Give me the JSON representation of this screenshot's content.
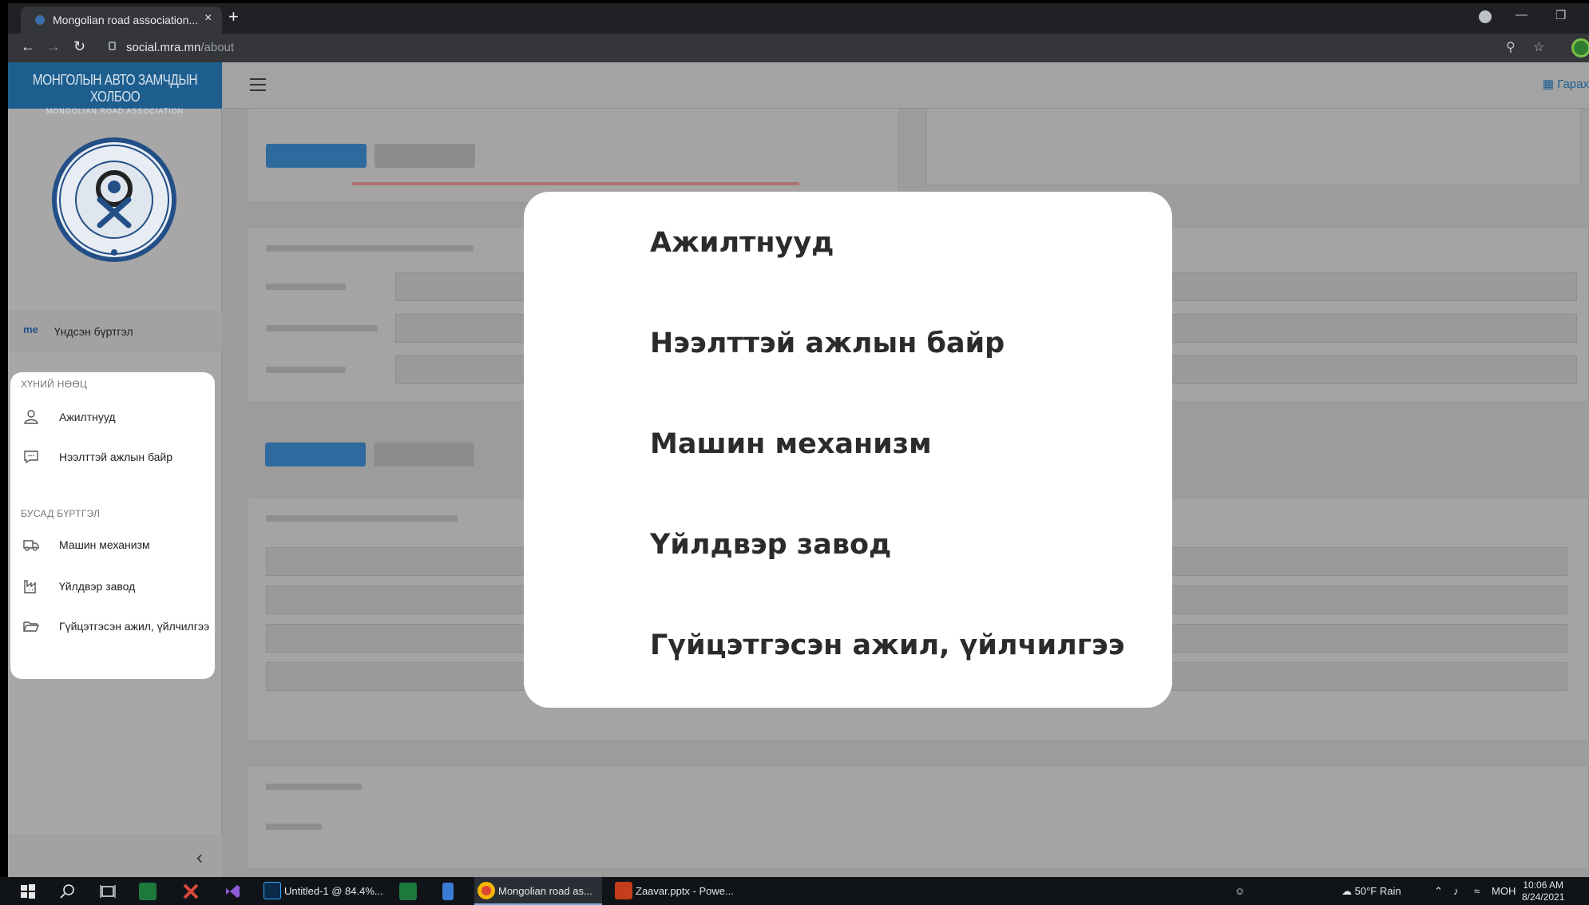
{
  "browser": {
    "tab_title": "Mongolian road association...",
    "new_tab": "+",
    "close_tab": "×",
    "url_host": "social.mra.mn",
    "url_path": "/about"
  },
  "sidebar": {
    "brand_title": "МОНГОЛЫН АВТО ЗАМЧДЫН ХОЛБОО",
    "brand_subtitle": "MONGOLIAN ROAD ASSOCIATION",
    "main_entry_badge": "me",
    "main_entry_label": "Үндсэн бүртгэл",
    "section_hr": "ХҮНИЙ НӨӨЦ",
    "section_other": "БУСАД БҮРТГЭЛ",
    "items": [
      {
        "label": "Ажилтнууд",
        "icon": "user-icon"
      },
      {
        "label": "Нээлттэй ажлын байр",
        "icon": "chat-icon"
      },
      {
        "label": "Машин механизм",
        "icon": "truck-icon"
      },
      {
        "label": "Үйлдвэр завод",
        "icon": "factory-icon"
      },
      {
        "label": "Гүйцэтгэсэн ажил, үйлчилгээ",
        "icon": "folder-icon"
      }
    ]
  },
  "topnav": {
    "logout_label": "Гарах"
  },
  "modal": {
    "items": [
      "Ажилтнууд",
      "Нээлттэй ажлын байр",
      "Машин механизм",
      "Үйлдвэр завод",
      "Гүйцэтгэсэн ажил, үйлчилгээ"
    ]
  },
  "taskbar": {
    "apps": [
      {
        "label": "Untitled-1 @ 84.4%..."
      },
      {
        "label": "Mongolian road as..."
      },
      {
        "label": "Zaavar.pptx - Powe..."
      }
    ],
    "weather": "50°F  Rain",
    "lang": "MOH",
    "time": "10:06 AM",
    "date": "8/24/2021"
  },
  "colors": {
    "brand": "#1d5e8f",
    "overlay_bg": "#9c9c9c",
    "card_bg": "#ffffff"
  }
}
